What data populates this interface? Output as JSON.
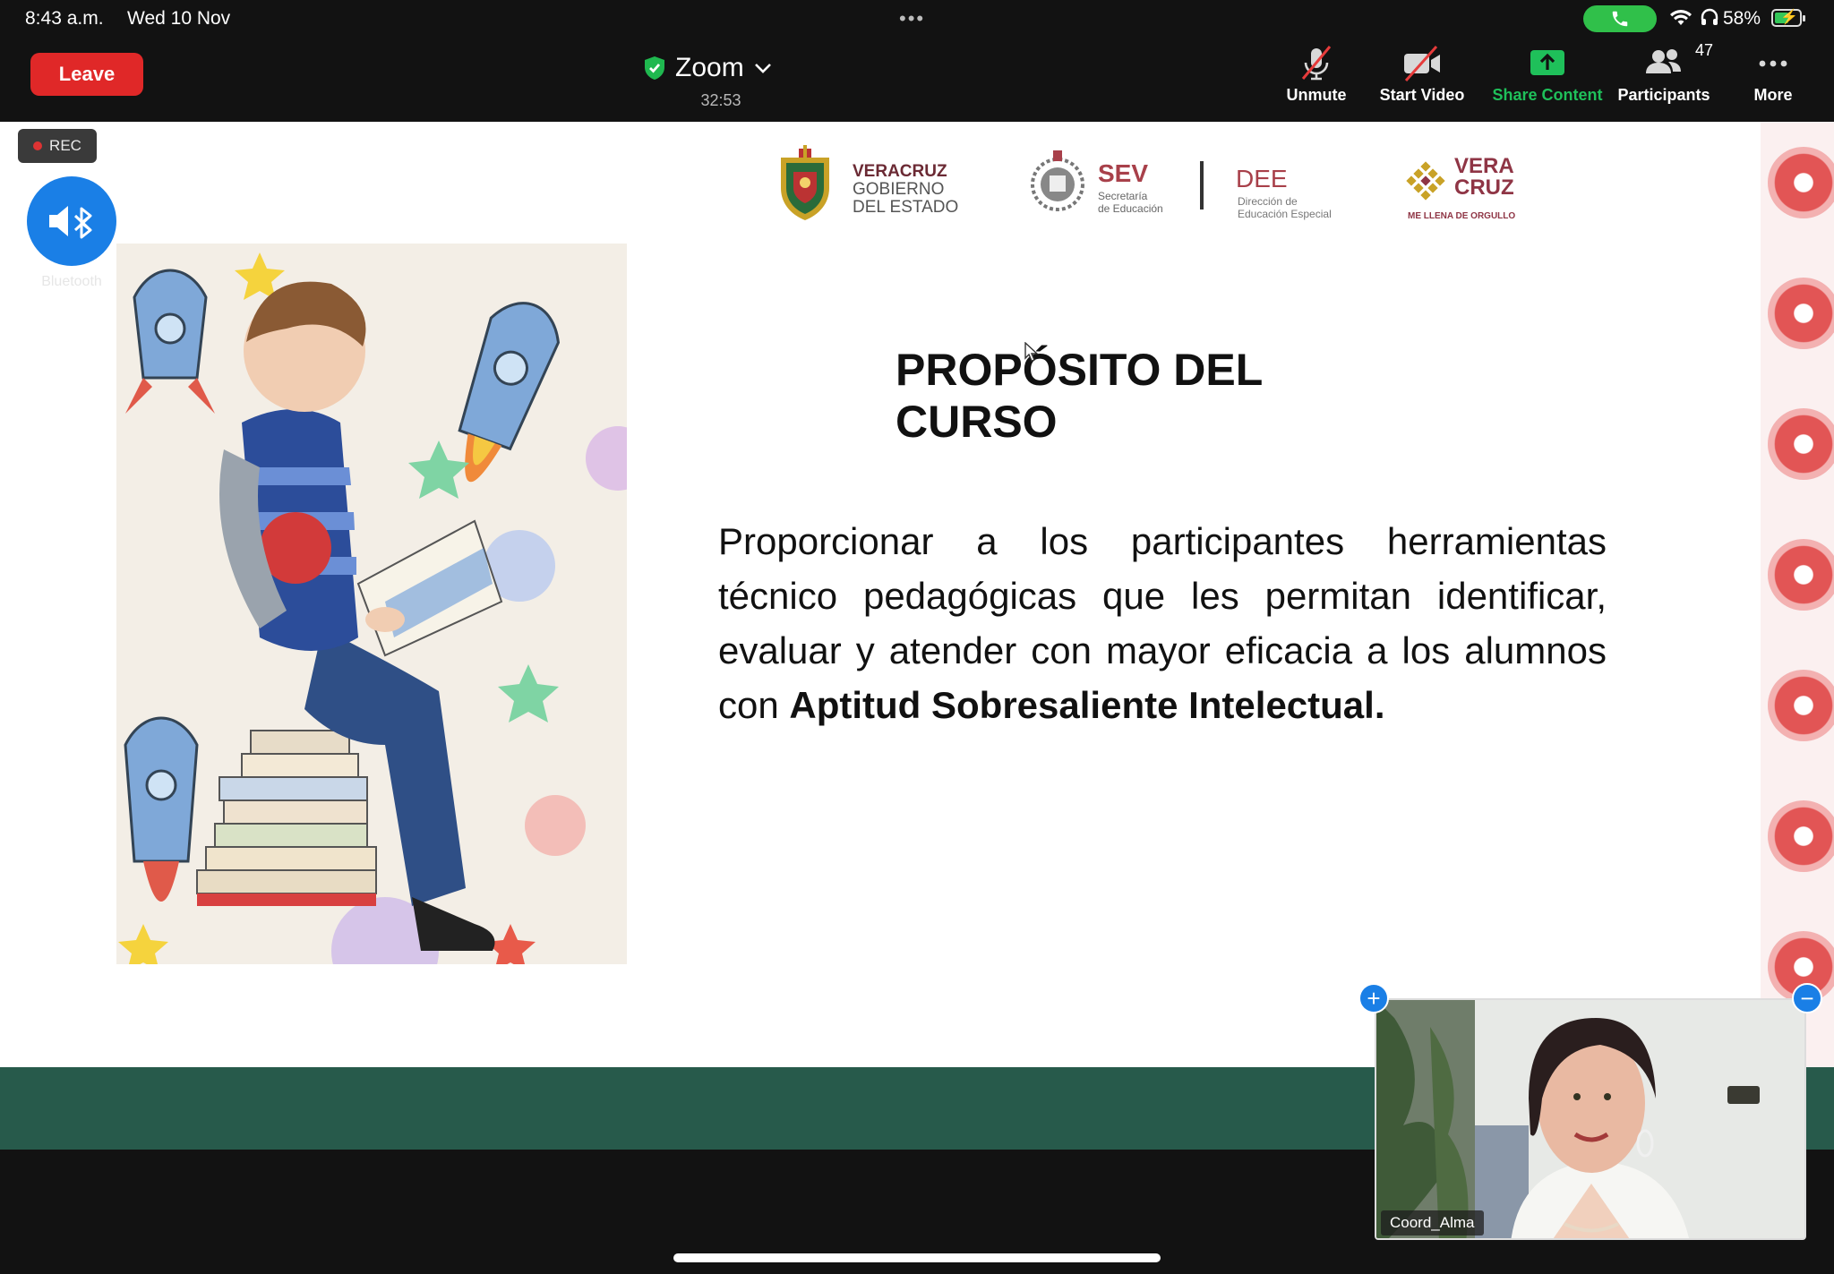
{
  "status_bar": {
    "time": "8:43 a.m.",
    "date": "Wed 10 Nov",
    "multitask_dots": "•••",
    "battery_percent": "58%",
    "battery_level": 0.58,
    "call_color": "#30c04a"
  },
  "toolbar": {
    "leave_label": "Leave",
    "meeting_title": "Zoom",
    "meeting_timer": "32:53",
    "unmute_label": "Unmute",
    "start_video_label": "Start Video",
    "share_content_label": "Share Content",
    "participants_label": "Participants",
    "participants_count": "47",
    "more_label": "More",
    "leave_color": "#e02828",
    "share_color": "#1fc05a"
  },
  "recording": {
    "label": "REC"
  },
  "audio": {
    "label": "Bluetooth"
  },
  "slide": {
    "logos": {
      "veracruz_line1": "VERACRUZ",
      "veracruz_line2": "GOBIERNO",
      "veracruz_line3": "DEL ESTADO",
      "sev_title": "SEV",
      "sev_sub_line1": "Secretaría",
      "sev_sub_line2": "de Educación",
      "dee_title": "DEE",
      "dee_sub_line1": "Dirección de",
      "dee_sub_line2": "Educación Especial",
      "brand_line1": "VERA",
      "brand_line2": "CRUZ",
      "brand_tagline": "ME LLENA DE ORGULLO"
    },
    "title": "PROPÓSITO DEL CURSO",
    "body_regular": "Proporcionar a los participantes herramientas técnico pedagógicas que les permitan identificar, evaluar y atender con mayor eficacia a los alumnos con ",
    "body_bold": "Aptitud Sobresaliente Intelectual.",
    "band_color": "#275a4b"
  },
  "video_tile": {
    "participant_name": "Coord_Alma",
    "expand_symbol": "+",
    "collapse_symbol": "−"
  }
}
